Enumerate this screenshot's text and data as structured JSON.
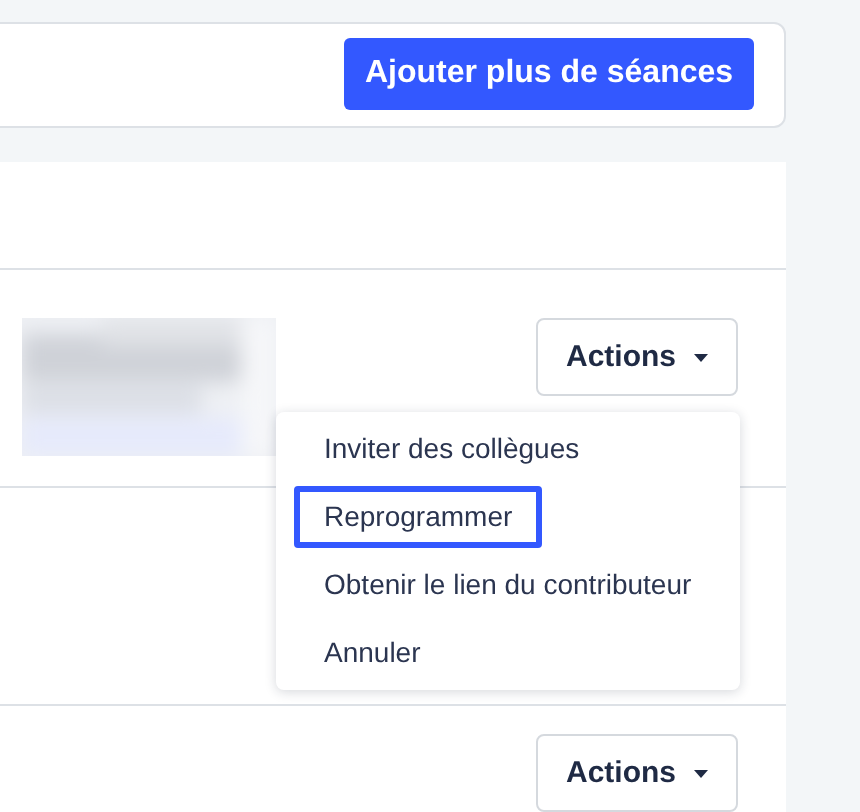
{
  "toolbar": {
    "button": "Ajouter plus de séances"
  },
  "sessions": [
    {
      "kind": "picture",
      "actions": {
        "label": "Actions"
      }
    },
    {
      "kind": "empty"
    },
    {
      "kind": "plain",
      "actions": {
        "label": "Actions"
      }
    }
  ],
  "menu": {
    "items": [
      {
        "label": "Inviter des collègues",
        "selected": false
      },
      {
        "label": "Reprogrammer",
        "selected": true
      },
      {
        "label": "Obtenir le lien du contributeur",
        "selected": false
      },
      {
        "label": "Annuler",
        "selected": false
      }
    ]
  }
}
